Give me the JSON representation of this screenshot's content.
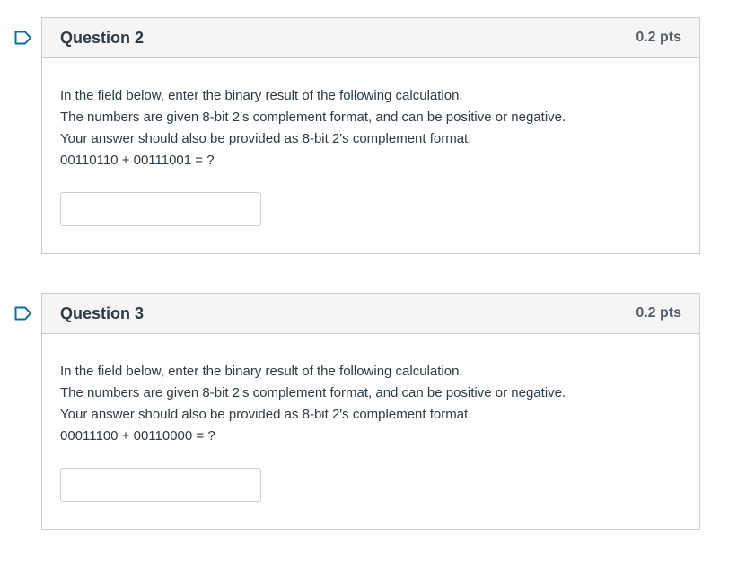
{
  "questions": [
    {
      "title": "Question 2",
      "points": "0.2 pts",
      "lines": [
        "In the field below, enter the binary result of the following calculation.",
        "The numbers are given 8-bit 2's complement format, and can be positive or negative.",
        "Your answer should also be provided as 8-bit 2's complement format.",
        "00110110 + 00111001 = ?"
      ],
      "answer_value": "",
      "flag_icon": "flag-icon"
    },
    {
      "title": "Question 3",
      "points": "0.2 pts",
      "lines": [
        "In the field below, enter the binary result of the following calculation.",
        "The numbers are given 8-bit 2's complement format, and can be positive or negative.",
        "Your answer should also be provided as 8-bit 2's complement format.",
        "00011100 + 00110000 = ?"
      ],
      "answer_value": "",
      "flag_icon": "flag-icon"
    }
  ],
  "colors": {
    "flag": "#0770a3",
    "border": "#c7cdd1",
    "header_bg": "#f5f5f5",
    "text": "#2d3b45"
  }
}
